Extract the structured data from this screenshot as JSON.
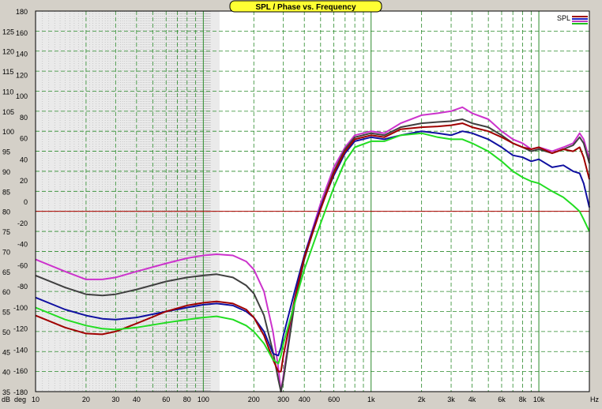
{
  "chart_data": {
    "type": "line",
    "title": "SPL / Phase vs. Frequency",
    "xlabel": "Hz",
    "x_scale": "log",
    "xlim": [
      10,
      20000
    ],
    "x_ticks": [
      10,
      20,
      30,
      40,
      60,
      80,
      100,
      200,
      300,
      400,
      600,
      1000,
      2000,
      3000,
      4000,
      6000,
      8000,
      10000
    ],
    "x_tick_labels": [
      "10",
      "20",
      "30",
      "40",
      "60",
      "80",
      "100",
      "200",
      "300",
      "400",
      "600",
      "1k",
      "2k",
      "3k",
      "4k",
      "6k",
      "8k",
      "10k"
    ],
    "y_left": {
      "label": "dB",
      "lim": [
        35,
        130
      ],
      "ticks": [
        35,
        40,
        45,
        50,
        55,
        60,
        65,
        70,
        75,
        80,
        85,
        90,
        95,
        100,
        105,
        110,
        115,
        120,
        125
      ]
    },
    "y_right": {
      "label": "deg",
      "lim": [
        -180,
        180
      ],
      "ticks": [
        -180,
        -160,
        -140,
        -120,
        -100,
        -80,
        -60,
        -40,
        -20,
        0,
        20,
        40,
        60,
        80,
        100,
        120,
        140,
        160,
        180
      ]
    },
    "reference_line": {
      "axis": "dB",
      "value": 80,
      "color": "#b00000"
    },
    "grid": true,
    "legend": {
      "position": "top-right",
      "label": "SPL",
      "swatch_colors": [
        "#a00000",
        "#2020c0",
        "#c040c0",
        "#20c020"
      ]
    },
    "series": [
      {
        "color": "#cc33cc",
        "x": [
          10,
          15,
          20,
          25,
          30,
          40,
          60,
          80,
          100,
          120,
          150,
          180,
          200,
          230,
          260,
          280,
          290,
          300,
          350,
          400,
          500,
          600,
          700,
          800,
          1000,
          1200,
          1500,
          2000,
          2500,
          3000,
          3500,
          4000,
          5000,
          6000,
          7000,
          8000,
          9000,
          10000,
          12000,
          14000,
          16000,
          17500,
          18500,
          20000
        ],
        "y": [
          68,
          65,
          63,
          63,
          63.5,
          65,
          67,
          68.3,
          69,
          69.3,
          69,
          67.5,
          65.5,
          60,
          50,
          41,
          35,
          39,
          58,
          69,
          82,
          91,
          96,
          99,
          100,
          99.5,
          102,
          104,
          104.5,
          105,
          106,
          104.5,
          103,
          100,
          98,
          97,
          95.5,
          96,
          95,
          96,
          97,
          99.5,
          98,
          93
        ]
      },
      {
        "color": "#404040",
        "x": [
          10,
          15,
          20,
          25,
          30,
          40,
          60,
          80,
          100,
          120,
          150,
          180,
          200,
          230,
          260,
          280,
          290,
          300,
          350,
          400,
          500,
          600,
          700,
          800,
          1000,
          1200,
          1500,
          2000,
          2500,
          3000,
          3500,
          4000,
          5000,
          6000,
          7000,
          8000,
          9000,
          10000,
          12000,
          14000,
          16000,
          17500,
          18500,
          20000
        ],
        "y": [
          64,
          61,
          59.3,
          59,
          59.3,
          60.5,
          62.5,
          63.5,
          64,
          64.3,
          63.5,
          61.5,
          59.5,
          54,
          45,
          38,
          35,
          38,
          57,
          68,
          81,
          90,
          95.5,
          98.5,
          99.5,
          99,
          101,
          102,
          102.3,
          102.5,
          103,
          102,
          101,
          99,
          97,
          96,
          95,
          95.5,
          94.5,
          95.5,
          96.5,
          98.5,
          97,
          92
        ]
      },
      {
        "color": "#1010a0",
        "x": [
          10,
          15,
          20,
          25,
          30,
          40,
          60,
          80,
          100,
          120,
          150,
          180,
          200,
          230,
          260,
          280,
          290,
          300,
          350,
          400,
          500,
          600,
          700,
          800,
          1000,
          1200,
          1500,
          2000,
          2500,
          3000,
          3500,
          4000,
          5000,
          6000,
          7000,
          8000,
          9000,
          10000,
          12000,
          14000,
          16000,
          17500,
          18500,
          20000
        ],
        "y": [
          58.5,
          55.5,
          54,
          53.2,
          53,
          53.5,
          55,
          56,
          56.7,
          57,
          56.5,
          55,
          53.5,
          50,
          44.5,
          44,
          46,
          49,
          60,
          69,
          81,
          89,
          94.5,
          97.5,
          98.5,
          98,
          99,
          100,
          99.5,
          99,
          100,
          99.5,
          98,
          96,
          94,
          93.5,
          92.5,
          93,
          91,
          91.5,
          90,
          89.5,
          87,
          81
        ]
      },
      {
        "color": "#a00000",
        "x": [
          10,
          15,
          20,
          25,
          30,
          40,
          60,
          80,
          100,
          120,
          150,
          180,
          200,
          230,
          260,
          280,
          290,
          300,
          350,
          400,
          500,
          600,
          700,
          800,
          1000,
          1200,
          1500,
          2000,
          2500,
          3000,
          3500,
          4000,
          5000,
          6000,
          7000,
          8000,
          9000,
          10000,
          12000,
          14000,
          16000,
          17500,
          18500,
          20000
        ],
        "y": [
          54,
          51,
          49.5,
          49.3,
          50,
          52,
          55,
          56.5,
          57.2,
          57.5,
          57,
          55.5,
          53.5,
          49,
          43,
          40,
          40,
          44,
          58,
          68.5,
          80.5,
          89.5,
          95,
          98,
          99,
          98.5,
          100.5,
          101,
          101.2,
          101.5,
          102,
          101,
          100,
          98.5,
          97,
          96,
          95.5,
          96,
          94.5,
          95.5,
          95,
          96,
          93.5,
          88
        ]
      },
      {
        "color": "#22dd22",
        "x": [
          10,
          15,
          20,
          25,
          30,
          40,
          60,
          80,
          100,
          120,
          150,
          180,
          200,
          230,
          260,
          280,
          290,
          300,
          350,
          400,
          500,
          600,
          700,
          800,
          1000,
          1200,
          1500,
          2000,
          2500,
          3000,
          3500,
          4000,
          5000,
          6000,
          7000,
          8000,
          9000,
          10000,
          12000,
          14000,
          16000,
          17500,
          18500,
          20000
        ],
        "y": [
          56,
          53,
          51.5,
          50.7,
          50.5,
          51,
          52.2,
          53,
          53.5,
          53.8,
          53,
          51.5,
          50,
          47,
          43,
          42,
          44,
          47,
          57,
          65.5,
          77,
          86,
          92.5,
          96,
          97.5,
          97.5,
          99,
          99.5,
          98.5,
          98,
          98,
          97,
          95,
          92.5,
          90,
          88.5,
          87.5,
          87,
          85,
          83.5,
          81.5,
          80,
          78,
          75
        ]
      }
    ]
  }
}
